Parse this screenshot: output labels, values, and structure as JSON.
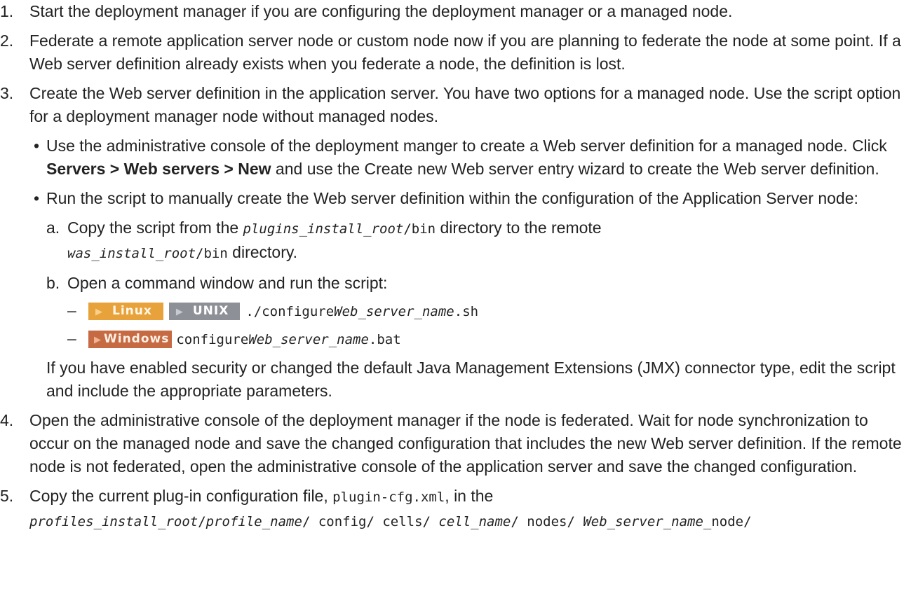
{
  "steps": {
    "s1": {
      "num": "1.",
      "text": "Start the deployment manager if you are configuring the deployment manager or a managed node."
    },
    "s2": {
      "num": "2.",
      "text": "Federate a remote application server node or custom node now if you are planning to federate the node at some point. If a Web server definition already exists when you federate a node, the definition is lost."
    },
    "s3": {
      "num": "3.",
      "text": "Create the Web server definition in the application server. You have two options for a managed node. Use the script option for a deployment manager node without managed nodes.",
      "bullet1": {
        "pre": "Use the administrative console of the deployment manger to create a Web server definition for a managed node. Click ",
        "path_servers": "Servers",
        "sep1": " > ",
        "path_web": "Web servers",
        "sep2": " > ",
        "path_new": "New",
        "post": " and use the Create new Web server entry wizard to create the Web server definition."
      },
      "bullet2": {
        "text": "Run the script to manually create the Web server definition within the configuration of the Application Server node:",
        "a": {
          "label": "a.",
          "pre": "Copy the script from the ",
          "var1": "plugins_install_root",
          "dir1": "/bin",
          "mid": " directory to the remote ",
          "var2": "was_install_root",
          "dir2": "/bin",
          "post": " directory."
        },
        "b": {
          "label": "b.",
          "text": "Open a command window and run the script:",
          "linux_badge": "Linux",
          "unix_badge": "UNIX",
          "windows_badge": "Windows",
          "dash": "–",
          "cmd1_pre": "./configure",
          "cmd1_var": "Web_server_name",
          "cmd1_post": ".sh",
          "cmd2_pre": "configure",
          "cmd2_var": "Web_server_name",
          "cmd2_post": ".bat"
        },
        "note": "If you have enabled security or changed the default Java Management Extensions (JMX) connector type, edit the script and include the appropriate parameters."
      }
    },
    "s4": {
      "num": "4.",
      "text": "Open the administrative console of the deployment manager if the node is federated. Wait for node synchronization to occur on the managed node and save the changed configuration that includes the new Web server definition. If the remote node is not federated, open the administrative console of the application server and save the changed configuration."
    },
    "s5": {
      "num": "5.",
      "pre": "Copy the current plug-in configuration file, ",
      "file": "plugin-cfg.xml",
      "mid": ", in the",
      "path_var1": "profiles_install_root",
      "sl1": "/",
      "path_var2": "profile_name",
      "seg1": "/ config/ cells/ ",
      "path_var3": "cell_name",
      "seg2": "/ nodes/ ",
      "path_var4": "Web_server_name",
      "seg3": "_node/"
    }
  }
}
